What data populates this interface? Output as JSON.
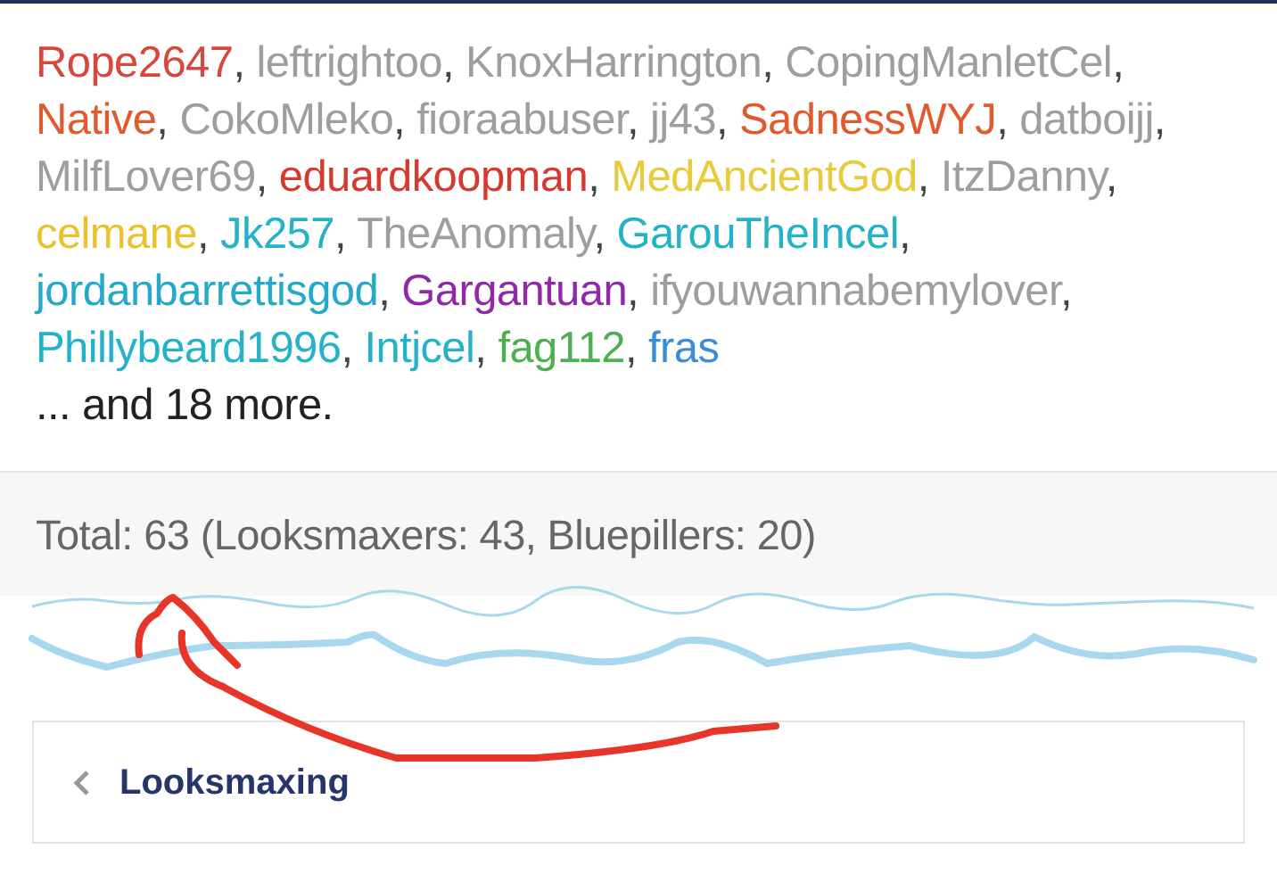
{
  "users": [
    {
      "name": "Rope2647",
      "color": "#d8473b",
      "separator": ","
    },
    {
      "name": "leftrightoo",
      "color": "#9e9e9e",
      "separator": ","
    },
    {
      "name": "KnoxHarrington",
      "color": "#9e9e9e",
      "separator": ","
    },
    {
      "name": "CopingManletCel",
      "color": "#9e9e9e",
      "separator": ","
    },
    {
      "name": "Native",
      "color": "#e05a2e",
      "separator": ","
    },
    {
      "name": "CokoMleko",
      "color": "#9e9e9e",
      "separator": ","
    },
    {
      "name": "fioraabuser",
      "color": "#9e9e9e",
      "separator": ","
    },
    {
      "name": "jj43",
      "color": "#9e9e9e",
      "separator": ","
    },
    {
      "name": "SadnessWYJ",
      "color": "#e05a2e",
      "separator": ","
    },
    {
      "name": "datboijj",
      "color": "#9e9e9e",
      "separator": ","
    },
    {
      "name": "MilfLover69",
      "color": "#9e9e9e",
      "separator": ","
    },
    {
      "name": "eduardkoopman",
      "color": "#d63a2f",
      "separator": ","
    },
    {
      "name": "MedAncientGod",
      "color": "#e8cb3c",
      "separator": ","
    },
    {
      "name": "ItzDanny",
      "color": "#9e9e9e",
      "separator": ","
    },
    {
      "name": "celmane",
      "color": "#e8c32e",
      "separator": ","
    },
    {
      "name": "Jk257",
      "color": "#23b2c7",
      "separator": ","
    },
    {
      "name": "TheAnomaly",
      "color": "#9e9e9e",
      "separator": ","
    },
    {
      "name": "GarouTheIncel",
      "color": "#23b2c7",
      "separator": ","
    },
    {
      "name": "jordanbarrettisgod",
      "color": "#23a9c9",
      "separator": ","
    },
    {
      "name": "Gargantuan",
      "color": "#8e2aa8",
      "separator": ","
    },
    {
      "name": "ifyouwannabemylover",
      "color": "#9e9e9e",
      "separator": ","
    },
    {
      "name": "Phillybeard1996",
      "color": "#23b2c7",
      "separator": ","
    },
    {
      "name": "Intjcel",
      "color": "#23b2c7",
      "separator": ","
    },
    {
      "name": "fag112",
      "color": "#4caf50",
      "separator": ","
    },
    {
      "name": "fras",
      "color": "#3a8dd6"
    }
  ],
  "more": "... and 18 more.",
  "total": "Total: 63 (Looksmaxers: 43, Bluepillers: 20)",
  "breadcrumb": {
    "label": "Looksmaxing"
  }
}
